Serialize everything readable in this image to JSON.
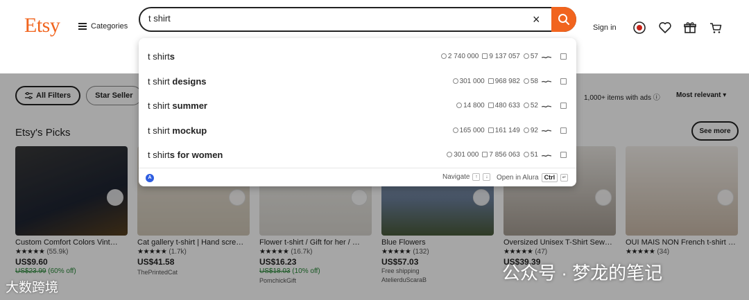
{
  "header": {
    "logo": "Etsy",
    "categories_label": "Categories",
    "search_value": "t shirt",
    "clear_symbol": "×",
    "sign_in": "Sign in",
    "brand_color": "#f1641e"
  },
  "suggestions": [
    {
      "base": "t shirt",
      "rest": "s",
      "searches": "2 740 000",
      "listings": "9 137 057",
      "views": "57"
    },
    {
      "base": "t shirt",
      "rest": " designs",
      "searches": "301 000",
      "listings": "968 982",
      "views": "58"
    },
    {
      "base": "t shirt",
      "rest": " summer",
      "searches": "14 800",
      "listings": "480 633",
      "views": "52"
    },
    {
      "base": "t shirt",
      "rest": " mockup",
      "searches": "165 000",
      "listings": "161 149",
      "views": "92"
    },
    {
      "base": "t shirt",
      "rest": "s for women",
      "searches": "301 000",
      "listings": "7 856 063",
      "views": "51"
    }
  ],
  "dropdown_footer": {
    "logo_letter": "A",
    "navigate_label": "Navigate",
    "open_label": "Open in Alura",
    "key_up": "↑",
    "key_down": "↓",
    "key_ctrl": "Ctrl",
    "key_enter": "↵"
  },
  "filters": {
    "all_filters": "All Filters",
    "star_seller": "Star Seller",
    "results_info": "1,000+ items with ads ⓘ",
    "sort_label": "Most relevant ▾"
  },
  "picks": {
    "title": "Etsy's Picks",
    "see_more": "See more"
  },
  "products": [
    {
      "title": "Custom Comfort Colors Vint…",
      "stars": "★★★★★",
      "reviews": "(55.9k)",
      "price": "US$9.60",
      "old_price": "US$23.99",
      "discount": "(60% off)",
      "shipping": "",
      "shop": ""
    },
    {
      "title": "Cat gallery t-shirt | Hand scre…",
      "stars": "★★★★★",
      "reviews": "(1.7k)",
      "price": "US$41.58",
      "old_price": "",
      "discount": "",
      "shipping": "",
      "shop": "ThePrintedCat"
    },
    {
      "title": "Flower t-shirt / Gift for her / …",
      "stars": "★★★★★",
      "reviews": "(16.7k)",
      "price": "US$16.23",
      "old_price": "US$18.03",
      "discount": "(10% off)",
      "shipping": "",
      "shop": "PomchickGift"
    },
    {
      "title": "Blue Flowers",
      "stars": "★★★★★",
      "reviews": "(132)",
      "price": "US$57.03",
      "old_price": "",
      "discount": "",
      "shipping": "Free shipping",
      "shop": "AtelierduScaraB"
    },
    {
      "title": "Oversized Unisex T-Shirt Sew…",
      "stars": "★★★★★",
      "reviews": "(47)",
      "price": "US$39.39",
      "old_price": "",
      "discount": "",
      "shipping": "",
      "shop": ""
    },
    {
      "title": "OUI MAIS NON French t-shirt …",
      "stars": "★★★★★",
      "reviews": "(34)",
      "price": "",
      "old_price": "",
      "discount": "",
      "shipping": "",
      "shop": ""
    }
  ],
  "watermarks": {
    "left": "大数跨境",
    "right": "公众号 · 梦龙的笔记"
  }
}
